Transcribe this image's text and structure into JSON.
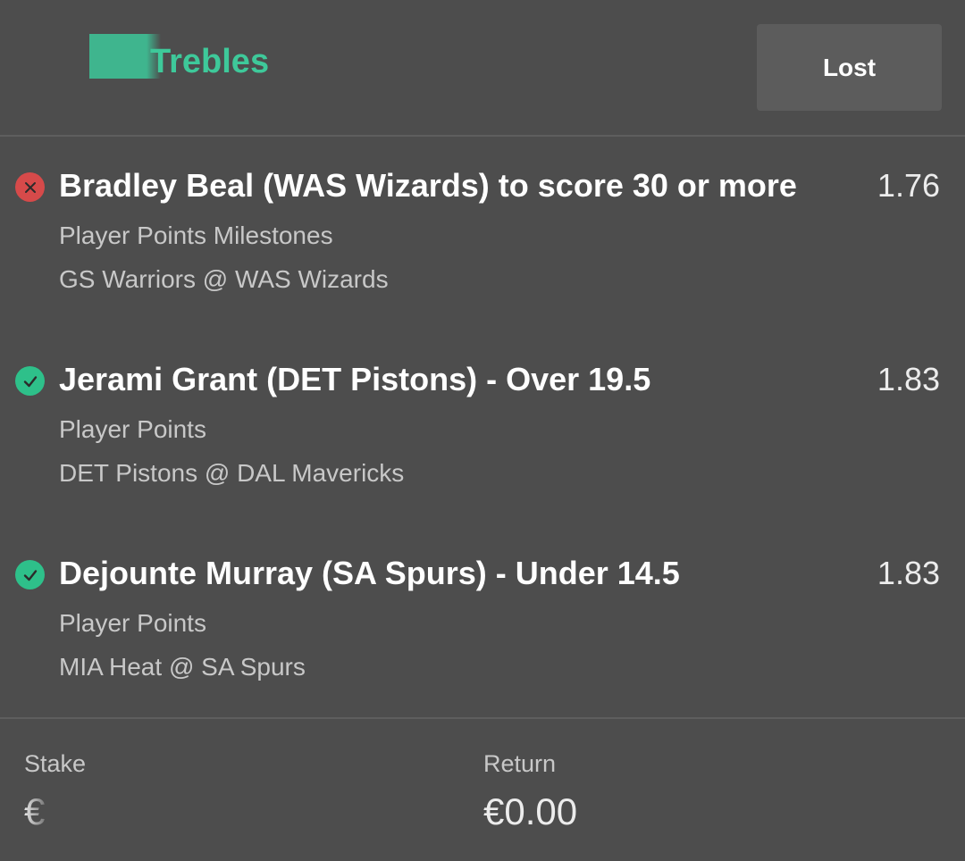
{
  "header": {
    "title": "Trebles",
    "status": "Lost"
  },
  "selections": [
    {
      "result": "lost",
      "name": "Bradley Beal (WAS Wizards) to score 30 or more",
      "odds": "1.76",
      "market": "Player Points Milestones",
      "event": "GS Warriors @ WAS Wizards"
    },
    {
      "result": "won",
      "name": "Jerami Grant (DET Pistons) - Over 19.5",
      "odds": "1.83",
      "market": "Player Points",
      "event": "DET Pistons @ DAL Mavericks"
    },
    {
      "result": "won",
      "name": "Dejounte Murray (SA Spurs) - Under 14.5",
      "odds": "1.83",
      "market": "Player Points",
      "event": "MIA Heat @ SA Spurs"
    }
  ],
  "footer": {
    "stake_label": "Stake",
    "stake_value": "€",
    "return_label": "Return",
    "return_value": "€0.00"
  },
  "colors": {
    "background": "#4d4d4d",
    "accent_green": "#3ec99a",
    "lost_red": "#d64a4a",
    "won_green": "#2ec08a"
  },
  "icons": {
    "lost": "close-icon",
    "won": "check-icon"
  }
}
